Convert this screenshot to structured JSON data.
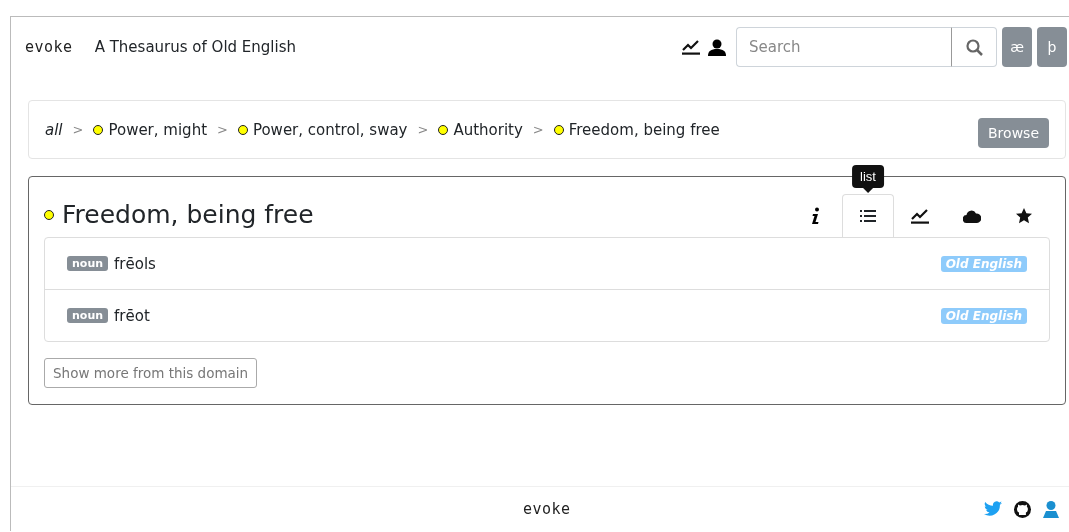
{
  "header": {
    "logo": "evoke",
    "title": "A Thesaurus of Old English",
    "search": {
      "placeholder": "Search"
    },
    "keys": [
      "æ",
      "þ"
    ]
  },
  "breadcrumb": {
    "root": "all",
    "items": [
      {
        "label": "Power, might",
        "color": "#ffff00"
      },
      {
        "label": "Power, control, sway",
        "color": "#ffff00"
      },
      {
        "label": "Authority",
        "color": "#ffff00"
      },
      {
        "label": "Freedom, being free",
        "color": "#ffff00"
      }
    ],
    "separator": ">",
    "browse": "Browse"
  },
  "domain": {
    "title": "Freedom, being free",
    "color": "#ffff00",
    "tabs": [
      {
        "kind": "info",
        "selected": false
      },
      {
        "kind": "list",
        "selected": true,
        "tooltip": "list"
      },
      {
        "kind": "chart",
        "selected": false
      },
      {
        "kind": "cloud",
        "selected": false
      },
      {
        "kind": "star",
        "selected": false
      }
    ],
    "words": [
      {
        "pos": "noun",
        "word": "frēols",
        "language": "Old English"
      },
      {
        "pos": "noun",
        "word": "frēot",
        "language": "Old English"
      }
    ],
    "more": "Show more from this domain"
  },
  "footer": {
    "logo": "evoke"
  }
}
